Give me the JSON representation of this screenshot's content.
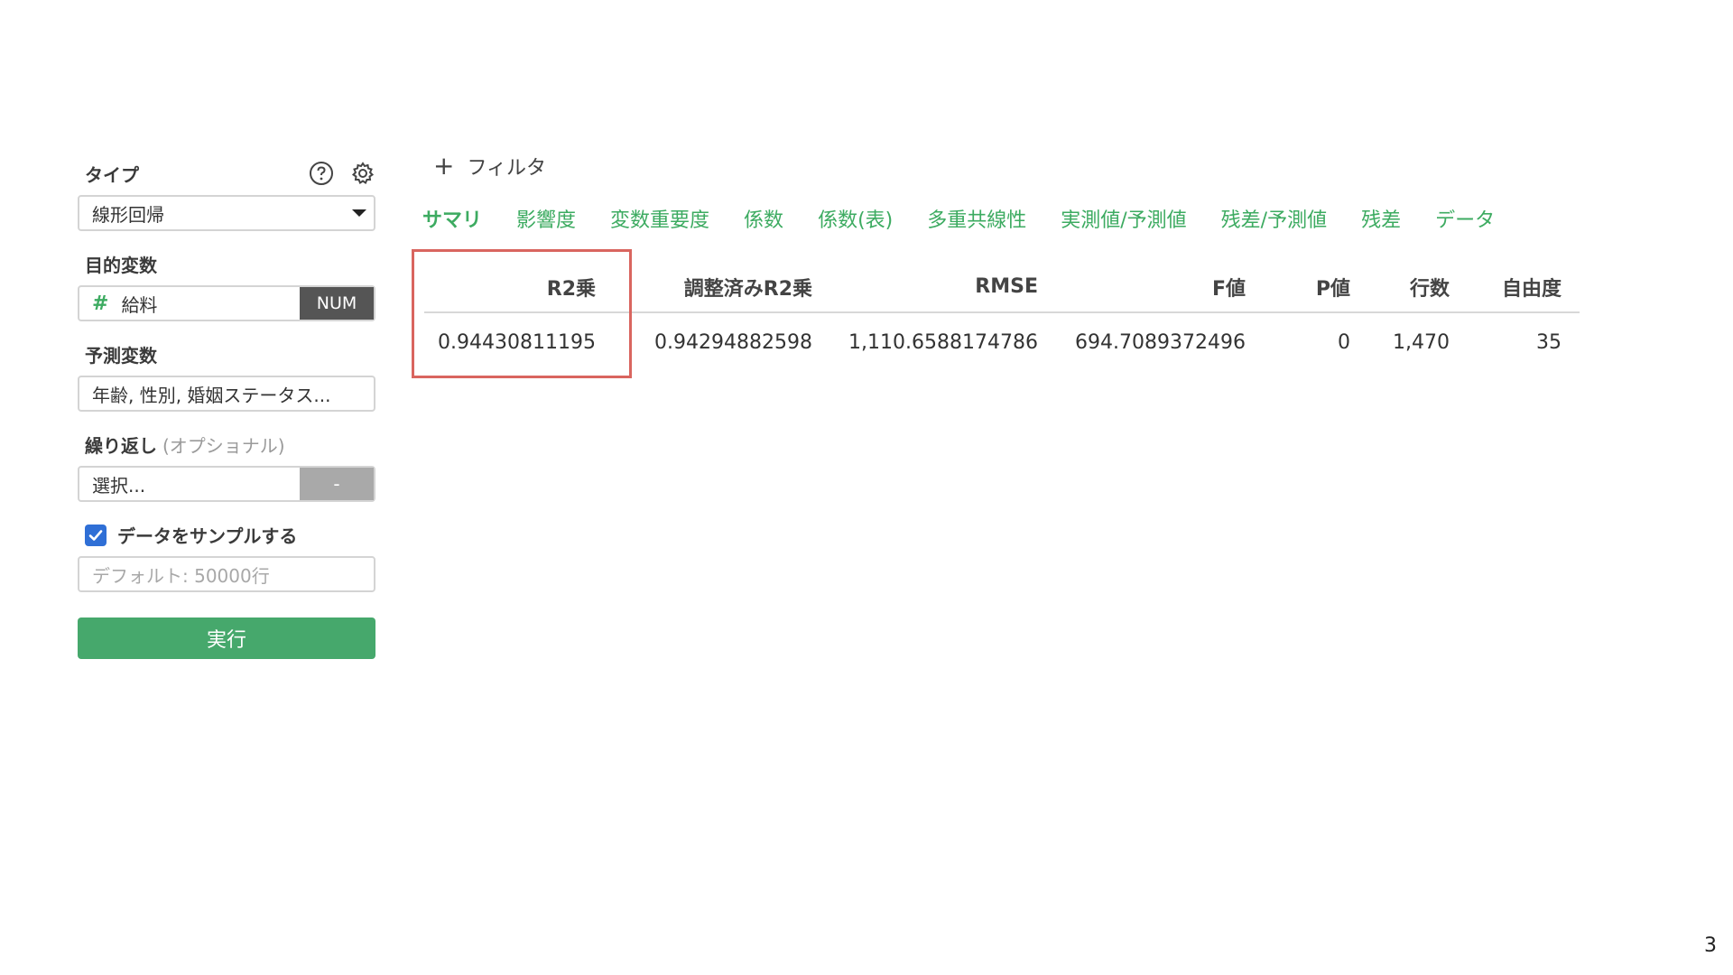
{
  "sidebar": {
    "type_label": "タイプ",
    "type_value": "線形回帰",
    "target_label": "目的変数",
    "target_value": "給料",
    "target_type_badge": "NUM",
    "predictors_label": "予測変数",
    "predictors_value": "年齢, 性別, 婚姻ステータス...",
    "repeat_label": "繰り返し",
    "repeat_optional": "(オプショナル)",
    "repeat_placeholder": "選択...",
    "repeat_button": "-",
    "sample_label": "データをサンプルする",
    "sample_checked": true,
    "sample_placeholder": "デフォルト: 50000行",
    "run_label": "実行"
  },
  "filter": {
    "add_label": "フィルタ"
  },
  "tabs": [
    {
      "label": "サマリ",
      "active": true
    },
    {
      "label": "影響度"
    },
    {
      "label": "変数重要度"
    },
    {
      "label": "係数"
    },
    {
      "label": "係数(表)"
    },
    {
      "label": "多重共線性"
    },
    {
      "label": "実測値/予測値"
    },
    {
      "label": "残差/予測値"
    },
    {
      "label": "残差"
    },
    {
      "label": "データ"
    }
  ],
  "summary_table": {
    "columns": [
      "R2乗",
      "調整済みR2乗",
      "RMSE",
      "F値",
      "P値",
      "行数",
      "自由度"
    ],
    "row": [
      "0.94430811195",
      "0.94294882598",
      "1,110.6588174786",
      "694.7089372496",
      "0",
      "1,470",
      "35"
    ]
  },
  "colors": {
    "accent": "#3dab61",
    "run_button": "#46a86c",
    "highlight": "#d9655f",
    "checkbox": "#2f6fd6"
  },
  "page_number": "3"
}
